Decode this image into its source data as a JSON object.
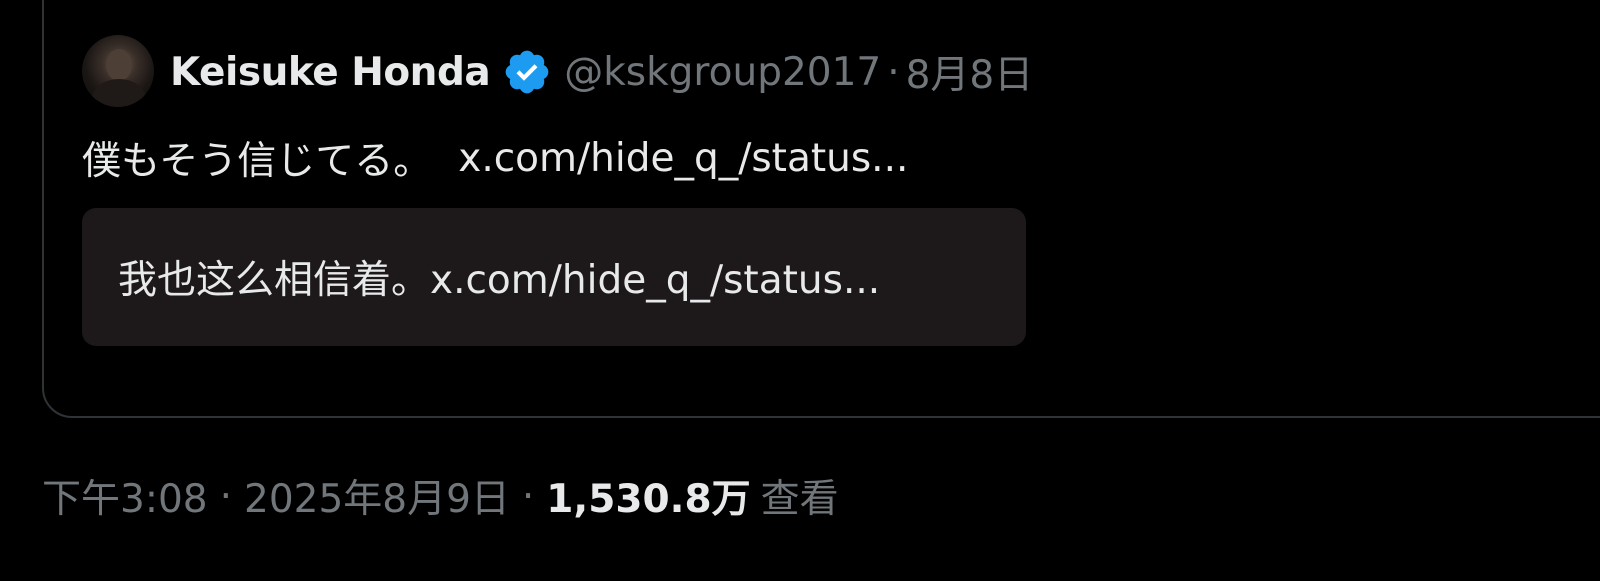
{
  "quoted_tweet": {
    "author": {
      "name": "Keisuke Honda",
      "verified": true,
      "handle": "@kskgroup2017",
      "separator": "·",
      "date": "8月8日"
    },
    "text": "僕もそう信じてる。",
    "link": "x.com/hide_q_/status...",
    "translation": "我也这么相信着。x.com/hide_q_/status..."
  },
  "post_meta": {
    "time": "下午3:08",
    "separator": "·",
    "date": "2025年8月9日",
    "separator2": "·",
    "views_count": "1,530.8万",
    "views_label": "查看"
  },
  "colors": {
    "background": "#000000",
    "primary_text": "#e7e9ea",
    "secondary_text": "#71767b",
    "border": "#2f3336",
    "translation_bg": "#1d1819",
    "verified_blue": "#1d9bf0"
  },
  "icons": {
    "verified": "verified-badge-icon"
  }
}
